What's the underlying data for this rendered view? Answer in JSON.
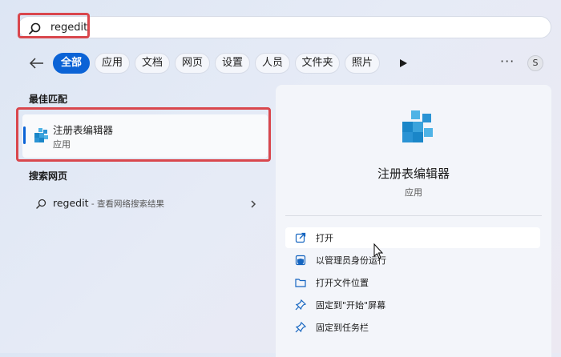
{
  "search": {
    "query": "regedit"
  },
  "filters": {
    "chips": [
      "全部",
      "应用",
      "文档",
      "网页",
      "设置",
      "人员",
      "文件夹",
      "照片"
    ],
    "more": "···",
    "avatar": "S"
  },
  "best_match": {
    "heading": "最佳匹配",
    "name": "注册表编辑器",
    "type": "应用"
  },
  "web": {
    "heading": "搜索网页",
    "query": "regedit",
    "hint": " - 查看网络搜索结果"
  },
  "details": {
    "title": "注册表编辑器",
    "type": "应用",
    "actions": [
      "打开",
      "以管理员身份运行",
      "打开文件位置",
      "固定到\"开始\"屏幕",
      "固定到任务栏"
    ]
  },
  "colors": {
    "accent": "#0b63d6",
    "highlight": "#d9474d"
  },
  "icons": [
    "search-icon",
    "back-arrow-icon",
    "play-icon",
    "registry-editor-icon",
    "open-icon",
    "shield-admin-icon",
    "folder-icon",
    "pin-icon",
    "chevron-right-icon"
  ]
}
